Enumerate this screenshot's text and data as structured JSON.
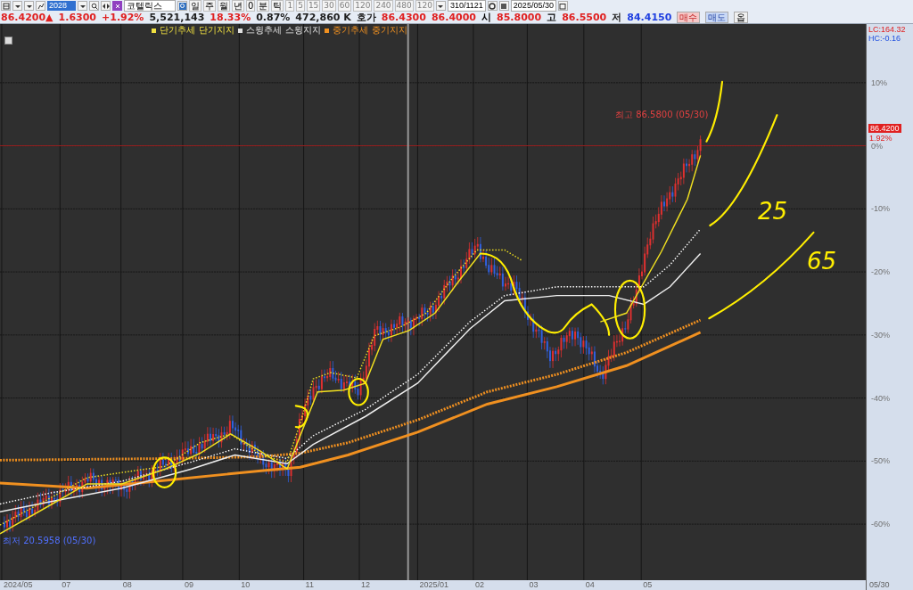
{
  "toolbar": {
    "code_field": "2028",
    "name_field": "코텔릭스",
    "period_buttons": [
      "일",
      "주",
      "월",
      "년",
      "0",
      "분",
      "틱"
    ],
    "interval_buttons": [
      "1",
      "5",
      "15",
      "30",
      "60",
      "120",
      "240",
      "480",
      "120"
    ],
    "count_field": "310/1121",
    "date_field": "2025/05/30"
  },
  "quote_bar": {
    "items": [
      {
        "text": "86.4200▲",
        "color": "#e02020"
      },
      {
        "text": "1.6300",
        "color": "#e02020"
      },
      {
        "text": "+1.92%",
        "color": "#e02020"
      },
      {
        "text": "5,521,143",
        "color": "#202020"
      },
      {
        "text": "18.33%",
        "color": "#e02020"
      },
      {
        "text": "0.87%",
        "color": "#202020"
      },
      {
        "text": "472,860 K",
        "color": "#202020"
      },
      {
        "text": "호가",
        "color": "#202020"
      },
      {
        "text": "86.4300",
        "color": "#e02020"
      },
      {
        "text": "86.4000",
        "color": "#e02020"
      },
      {
        "text": "시",
        "color": "#000000"
      },
      {
        "text": "85.8000",
        "color": "#e02020"
      },
      {
        "text": "고",
        "color": "#000000"
      },
      {
        "text": "86.5500",
        "color": "#e02020"
      },
      {
        "text": "저",
        "color": "#202020"
      },
      {
        "text": "84.4150",
        "color": "#2040e0"
      }
    ],
    "buttons": [
      {
        "label": "매수",
        "kind": "buy"
      },
      {
        "label": "매도",
        "kind": "sell"
      },
      {
        "label": "옵",
        "kind": "plain"
      }
    ]
  },
  "legend": [
    {
      "labels": [
        "단기추세",
        "단기지지"
      ],
      "color": "#f0e040"
    },
    {
      "labels": [
        "스윙추세",
        "스윙지지"
      ],
      "color": "#e0e0e0"
    },
    {
      "labels": [
        "중기추세",
        "중기지지"
      ],
      "color": "#f09020"
    }
  ],
  "chart": {
    "high_label": "최고 86.5800 (05/30)",
    "low_label": "최저 20.5958 (05/30)",
    "annotations": [
      "25",
      "65"
    ],
    "right_axis": {
      "header": [
        "LC:164.32",
        "HC:-0.16"
      ],
      "ticks": [
        "10%",
        "0%",
        "-10%",
        "-20%",
        "-30%",
        "-40%",
        "-50%",
        "-60%"
      ],
      "price_tag": "86.4200",
      "price_change": "1.92%"
    },
    "x_axis": {
      "ticks": [
        "2024/05",
        "07",
        "08",
        "09",
        "10",
        "11",
        "12",
        "2025/01",
        "02",
        "03",
        "04",
        "05"
      ],
      "end_date": "05/30"
    }
  }
}
